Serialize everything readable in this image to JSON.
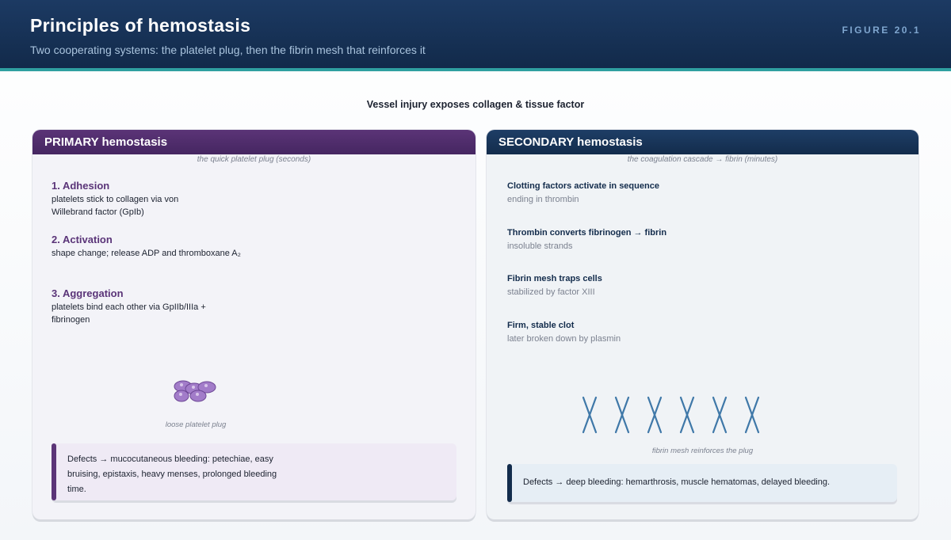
{
  "header": {
    "title": "Principles of hemostasis",
    "subtitle": "Two cooperating systems: the platelet plug, then the fibrin mesh that reinforces it",
    "figure_label": "FIGURE 20.1"
  },
  "trigger": "Vessel injury exposes collagen & tissue factor",
  "primary": {
    "title": "PRIMARY hemostasis",
    "subtitle": "the quick platelet plug (seconds)",
    "steps": [
      {
        "heading": "1. Adhesion",
        "body": "platelets stick to collagen via von Willebrand factor (GpIb)"
      },
      {
        "heading": "2. Activation",
        "body": "shape change; release ADP and thromboxane A₂"
      },
      {
        "heading": "3. Aggregation",
        "body": "platelets bind each other via GpIIb/IIIa + fibrinogen"
      }
    ],
    "illustration_caption": "loose platelet plug",
    "defects": "Defects → mucocutaneous bleeding: petechiae, easy bruising, epistaxis, heavy menses, prolonged bleeding time.",
    "accent_color": "#5b3477"
  },
  "secondary": {
    "title": "SECONDARY hemostasis",
    "subtitle": "the coagulation cascade → fibrin (minutes)",
    "steps": [
      {
        "heading": "Clotting factors activate in sequence",
        "body": "ending in thrombin"
      },
      {
        "heading": "Thrombin converts fibrinogen → fibrin",
        "body": "insoluble strands"
      },
      {
        "heading": "Fibrin mesh traps cells",
        "body": "stabilized by factor XIII"
      },
      {
        "heading": "Firm, stable clot",
        "body": "later broken down by plasmin"
      }
    ],
    "illustration_caption": "fibrin mesh reinforces the plug",
    "defects": "Defects → deep bleeding: hemarthrosis, muscle hematomas, delayed bleeding.",
    "accent_color": "#132c4c"
  }
}
